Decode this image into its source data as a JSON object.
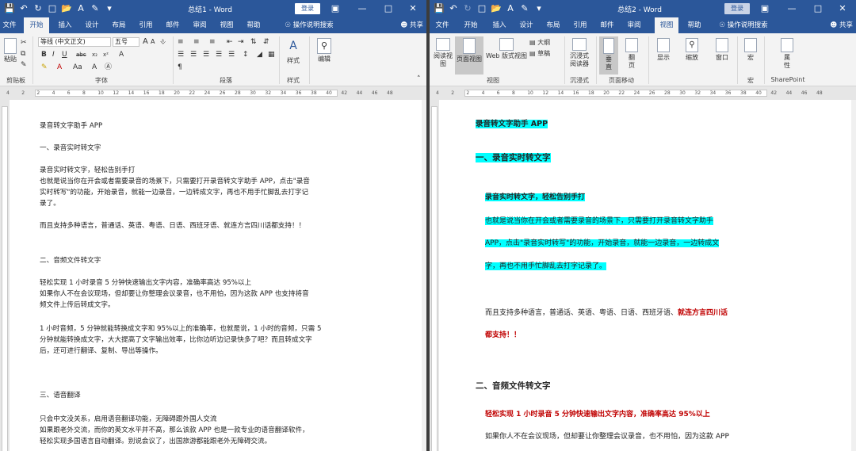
{
  "left": {
    "title": "总结1 - Word",
    "login": "登录",
    "tabs": [
      "文件",
      "开始",
      "插入",
      "设计",
      "布局",
      "引用",
      "邮件",
      "审阅",
      "视图",
      "帮助"
    ],
    "tell_me": "操作说明搜索",
    "share": "共享",
    "ribbon": {
      "paste": "粘贴",
      "clipboard": "剪贴板",
      "font_name": "等线 (中文正文)",
      "font_size": "五号",
      "font_group": "字体",
      "paragraph_group": "段落",
      "styles_button": "样式",
      "styles_group": "样式",
      "editing_button": "编辑"
    },
    "doc": {
      "l1": "录音转文字助手 APP",
      "l2": "一、录音实时转文字",
      "l3": "录音实时转文字，轻松告别手打",
      "l4": "也就是说当你在开会或者需要录音的场景下，只需要打开录音转文字助手 APP，点击\"录音",
      "l5": "实时转写\"的功能，开始录音，就能一边录音，一边转成文字，再也不用手忙脚乱去打字记",
      "l6": "录了。",
      "l7": "而且支持多种语言，普通话、英语、粤语、日语、西班牙语、就连方言四川话都支持！！",
      "l8": "二、音频文件转文字",
      "l9": "轻松实现 1 小时录音 5 分钟快速输出文字内容，准确率高达 95%以上",
      "l10": "如果你人不在会议现场，但却要让你整理会议录音，也不用怕，因为这款 APP 也支持将音",
      "l11": "频文件上传后转成文字。",
      "l12": "1 小时音频，5 分钟就能转换成文字和 95%以上的准确率，也就是说，1 小时的音频，只需 5",
      "l13": "分钟就能转换成文字，大大提高了文字输出效率，比你边听边记录快多了吧？而且转成文字",
      "l14": "后，还可进行翻译、复制、导出等操作。",
      "l15": "三、语音翻译",
      "l16": "只会中文没关系，启用语音翻译功能，无障碍跟外国人交流",
      "l17": "如果跟老外交流，而你的英文水平并不高，那么该款 APP 也是一款专业的语音翻译软件，",
      "l18": "轻松实现多国语言自动翻译。别说会议了，出国旅游都能跟老外无障碍交流。"
    }
  },
  "right": {
    "title": "总结2 - Word",
    "login": "登录",
    "tabs": [
      "文件",
      "开始",
      "插入",
      "设计",
      "布局",
      "引用",
      "邮件",
      "审阅",
      "视图",
      "帮助"
    ],
    "tell_me": "操作说明搜索",
    "share": "共享",
    "ribbon": {
      "read_mode": "阅读视图",
      "print_layout": "页面视图",
      "web_layout": "Web 版式视图",
      "outline": "大纲",
      "draft": "草稿",
      "views_group": "视图",
      "immersive": "沉浸式阅读器",
      "immersive_group": "沉浸式",
      "vertical": "垂直",
      "side_to_side": "翻页",
      "page_movement_group": "页面移动",
      "show": "显示",
      "zoom": "缩放",
      "window": "窗口",
      "macros": "宏",
      "macros_group": "宏",
      "properties": "属性",
      "sharepoint_group": "SharePoint"
    },
    "doc": {
      "r1": "录音转文字助手 APP",
      "r2": "一、录音实时转文字",
      "r3": "录音实时转文字，轻松告别手打",
      "r4": "也就是说当你在开会或者需要录音的场景下，只需要打开录音转文字助手",
      "r5": "APP，点击\"录音实时转写\"的功能，开始录音，就能一边录音，一边转成文",
      "r6": "字，再也不用手忙脚乱去打字记录了。",
      "r7a": "而且支持多种语言，普通话、英语、粤语、日语、西班牙语、",
      "r7b": "就连方言四川话",
      "r8": "都支持！！",
      "r9": "二、音频文件转文字",
      "r10": "轻松实现 1 小时录音 5 分钟快速输出文字内容，准确率高达 95%以上",
      "r11": "如果你人不在会议现场，但却要让你整理会议录音，也不用怕，因为这款 APP"
    }
  },
  "ruler_numbers": [
    "4",
    "2",
    "2",
    "4",
    "6",
    "8",
    "10",
    "12",
    "14",
    "16",
    "18",
    "20",
    "22",
    "24",
    "26",
    "28",
    "30",
    "32",
    "34",
    "36",
    "38",
    "40",
    "42",
    "44",
    "46",
    "48"
  ],
  "colors": {
    "titlebar": "#2b579a",
    "highlight": "#00ffff",
    "red_text": "#c00000"
  }
}
